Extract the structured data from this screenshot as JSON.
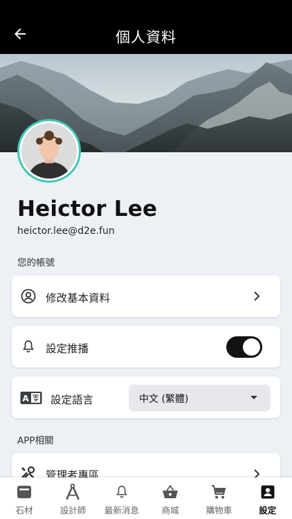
{
  "header": {
    "title": "個人資料",
    "back_icon": "arrow-left-icon"
  },
  "profile": {
    "name": "Heictor Lee",
    "email": "heictor.lee@d2e.fun"
  },
  "sections": {
    "account": "您的帳號",
    "app": "APP相關"
  },
  "account_items": {
    "edit_profile": {
      "label": "修改基本資料",
      "icon": "account-circle-icon"
    },
    "push": {
      "label": "設定推播",
      "icon": "bell-icon",
      "enabled": true
    },
    "language": {
      "label": "設定語言",
      "icon": "translate-icon",
      "value": "中文 (繁體)"
    }
  },
  "app_items": {
    "admin": {
      "label": "管理者專區",
      "icon": "tools-icon"
    }
  },
  "bottom_nav": [
    {
      "label": "石材",
      "icon": "stone-icon"
    },
    {
      "label": "設計師",
      "icon": "compass-icon"
    },
    {
      "label": "最新消息",
      "icon": "bell-icon"
    },
    {
      "label": "商城",
      "icon": "basket-icon"
    },
    {
      "label": "購物車",
      "icon": "cart-icon"
    },
    {
      "label": "設定",
      "icon": "account-box-icon",
      "active": true
    }
  ],
  "colors": {
    "topbar": "#000000",
    "avatar_ring": "#3ec7b2",
    "background": "#edf1f6",
    "toggle_on": "#111111"
  }
}
